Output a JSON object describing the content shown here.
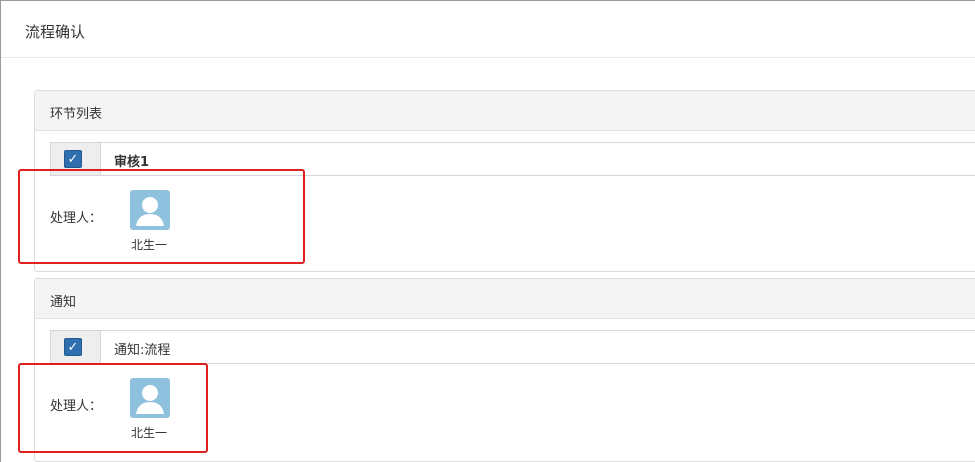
{
  "dialog": {
    "title": "流程确认"
  },
  "sections": [
    {
      "header": "环节列表",
      "item": {
        "label": "审核1",
        "checked": true
      },
      "handler_label": "处理人：",
      "handler": {
        "name": "北生一",
        "icon": "user-avatar-icon"
      }
    },
    {
      "header": "通知",
      "item": {
        "label": "通知:流程",
        "checked": true
      },
      "handler_label": "处理人：",
      "handler": {
        "name": "北生一",
        "icon": "user-avatar-icon"
      }
    }
  ],
  "colors": {
    "checkbox": "#2f6fb0",
    "avatar": "#8ec1dd",
    "highlight": "#e02020"
  }
}
